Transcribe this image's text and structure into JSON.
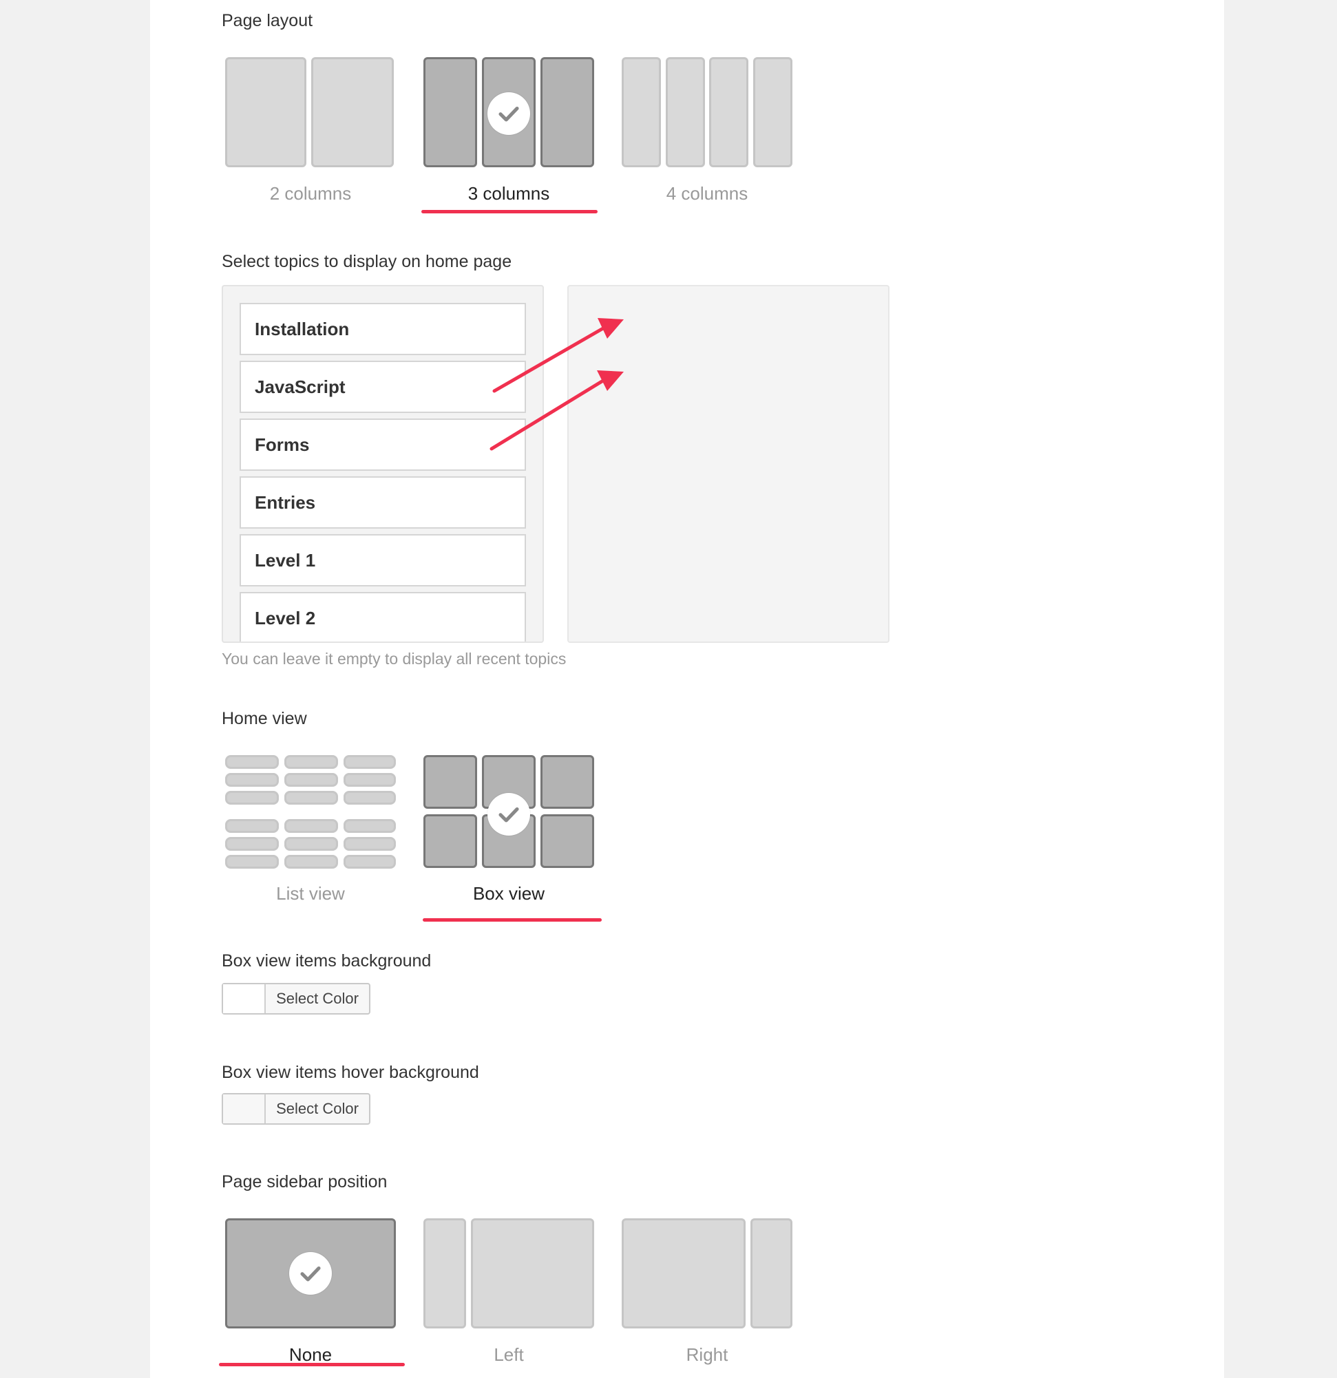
{
  "colors": {
    "accent": "#f0304f",
    "selected": "#b3b3b3",
    "unselected": "#d9d9d9"
  },
  "page_layout": {
    "label": "Page layout",
    "options": [
      {
        "label": "2 columns",
        "selected": false
      },
      {
        "label": "3 columns",
        "selected": true
      },
      {
        "label": "4 columns",
        "selected": false
      }
    ]
  },
  "topics": {
    "label": "Select topics to display on home page",
    "items": [
      "Installation",
      "JavaScript",
      "Forms",
      "Entries",
      "Level 1",
      "Level 2"
    ],
    "hint": "You can leave it empty to display all recent topics"
  },
  "home_view": {
    "label": "Home view",
    "options": [
      {
        "label": "List view",
        "selected": false
      },
      {
        "label": "Box view",
        "selected": true
      }
    ]
  },
  "box_bg": {
    "label": "Box view items background",
    "button": "Select Color"
  },
  "box_hover_bg": {
    "label": "Box view items hover background",
    "button": "Select Color"
  },
  "sidebar": {
    "label": "Page sidebar position",
    "options": [
      {
        "label": "None",
        "selected": true
      },
      {
        "label": "Left",
        "selected": false
      },
      {
        "label": "Right",
        "selected": false
      }
    ]
  },
  "icons": {
    "check": "checkmark-icon",
    "arrow": "arrow-icon"
  }
}
